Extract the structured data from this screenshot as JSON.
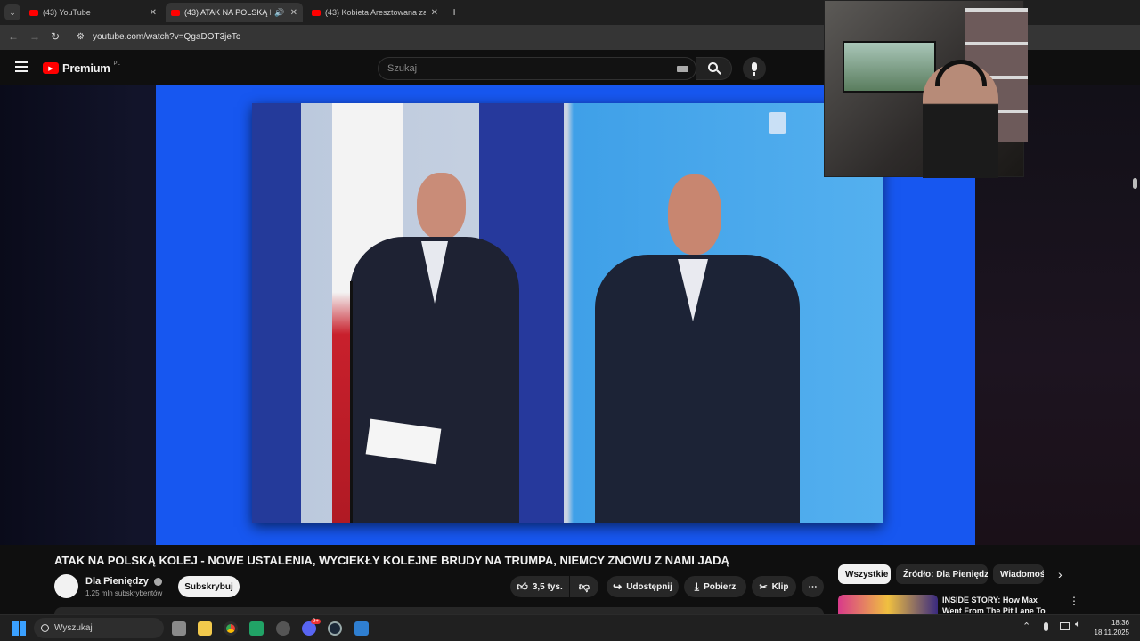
{
  "browser": {
    "tabs": [
      {
        "title": "(43) YouTube",
        "active": false
      },
      {
        "title": "(43) ATAK NA POLSKĄ KOL",
        "active": true
      },
      {
        "title": "(43) Kobieta Aresztowana za Uj",
        "active": false
      }
    ],
    "url": "youtube.com/watch?v=QgaDOT3jeTc"
  },
  "header": {
    "logo": "Premium",
    "logo_region": "PL",
    "search_placeholder": "Szukaj"
  },
  "video": {
    "title": "ATAK NA POLSKĄ KOLEJ - NOWE USTALENIA, WYCIEKŁY KOLEJNE BRUDY NA TRUMPA, NIEMCY ZNOWU Z NAMI JADĄ",
    "channel": "Dla Pieniędzy",
    "subscribers": "1,25 mln subskrybentów",
    "subscribe_label": "Subskrybuj",
    "likes": "3,5 tys.",
    "share_label": "Udostępnij",
    "download_label": "Pobierz",
    "clip_label": "Klip"
  },
  "sidebar": {
    "chips": [
      "Wszystkie",
      "Źródło: Dla Pieniędzy",
      "Wiadomości"
    ],
    "rec_title": "INSIDE STORY: How Max Went From The Pit Lane To Podium |"
  },
  "taskbar": {
    "search_label": "Wyszukaj",
    "time": "18:36",
    "date": "18.11.2025",
    "discord_badge": "9+"
  }
}
